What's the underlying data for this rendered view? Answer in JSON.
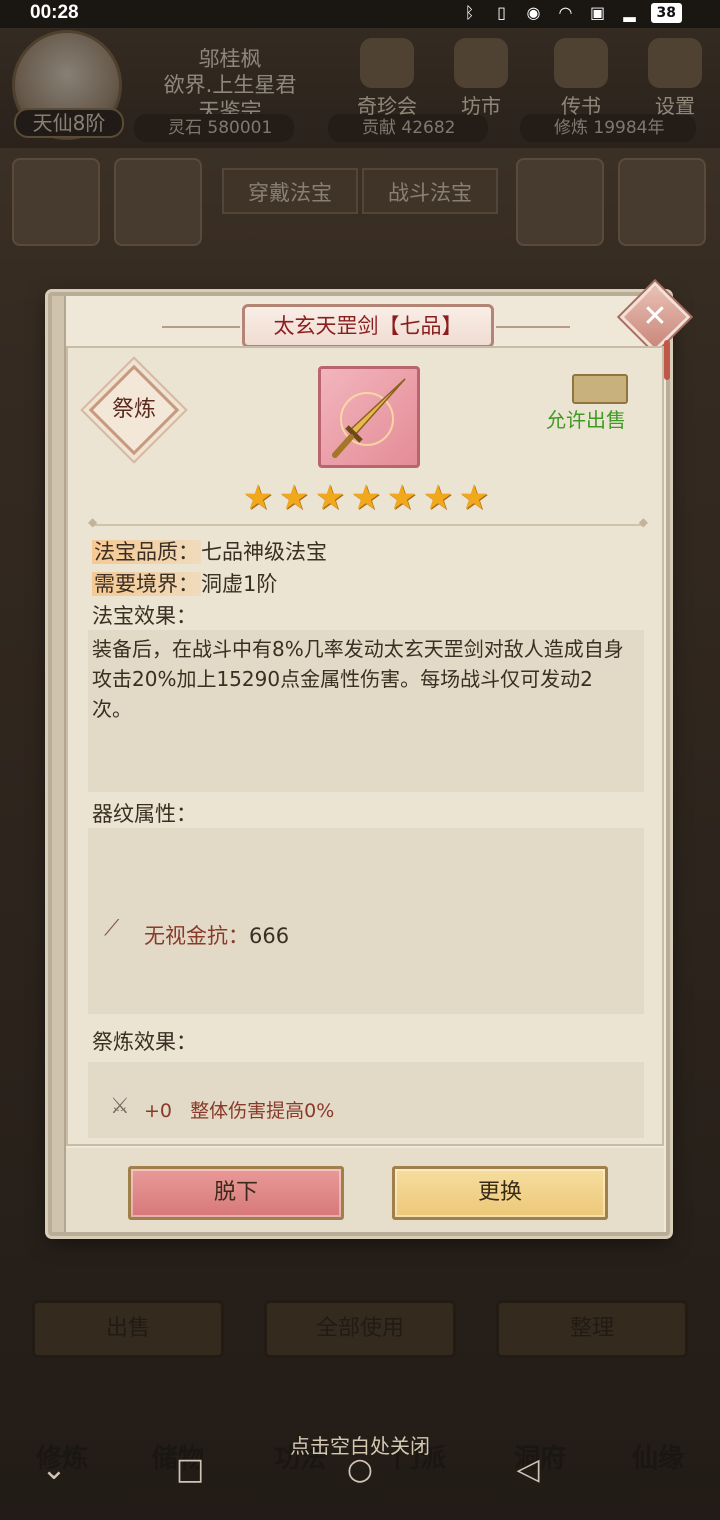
{
  "status": {
    "time": "00:28",
    "battery": "38"
  },
  "player": {
    "name_line1": "邬桂枫",
    "name_line2": "欲界.上生星君",
    "name_line3": "天鉴宗",
    "rank": "天仙8阶",
    "spirit_stone": "灵石 580001",
    "contribution": "贡献 42682",
    "cultivation": "修炼 19984年"
  },
  "top_nav": [
    "奇珍会",
    "坊市",
    "传书",
    "设置"
  ],
  "bg_tabs": {
    "wear": "穿戴法宝",
    "battle": "战斗法宝"
  },
  "bg_bottom": {
    "sell": "出售",
    "use_all": "全部使用",
    "sort": "整理"
  },
  "main_nav": [
    "修炼",
    "储物",
    "功法",
    "门派",
    "洞府",
    "仙缘"
  ],
  "close_hint": "点击空白处关闭",
  "modal": {
    "title": "太玄天罡剑【七品】",
    "refine_label": "祭炼",
    "sale_label": "允许出售",
    "stars": 7,
    "quality_key": "法宝品质：",
    "quality_val": "七品神级法宝",
    "realm_key": "需要境界：",
    "realm_val": "洞虚1阶",
    "effect_title": "法宝效果：",
    "effect_desc": "装备后，在战斗中有8%几率发动太玄天罡剑对敌人造成自身攻击20%加上15290点金属性伤害。每场战斗仅可发动2次。",
    "pattern_title": "器纹属性：",
    "pattern_attr_key": "无视金抗：",
    "pattern_attr_val": "666",
    "refine_title": "祭炼效果：",
    "refine_effect_level": "+0",
    "refine_effect_text": "整体伤害提高0%",
    "btn_remove": "脱下",
    "btn_replace": "更换"
  }
}
